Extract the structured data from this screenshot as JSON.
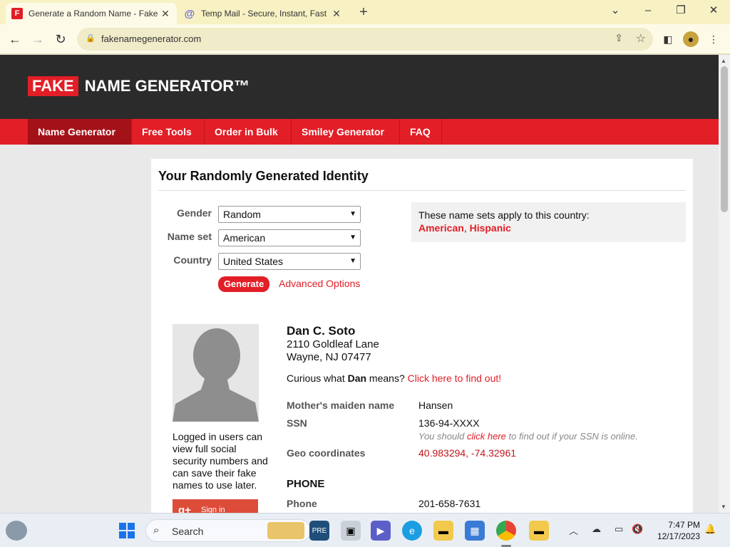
{
  "browser": {
    "tabs": [
      {
        "title": "Generate a Random Name - Fake",
        "favicon": "F",
        "active": true
      },
      {
        "title": "Temp Mail - Secure, Instant, Fast",
        "favicon": "@",
        "active": false
      }
    ],
    "url": "fakenamegenerator.com"
  },
  "site": {
    "logo_fake": "FAKE",
    "logo_rest": "NAME GENERATOR™",
    "nav": [
      "Name Generator",
      "Free Tools",
      "Order in Bulk",
      "Smiley Generator",
      "FAQ"
    ]
  },
  "form": {
    "heading": "Your Randomly Generated Identity",
    "gender_label": "Gender",
    "gender_value": "Random",
    "nameset_label": "Name set",
    "nameset_value": "American",
    "country_label": "Country",
    "country_value": "United States",
    "generate_label": "Generate",
    "advanced_label": "Advanced Options",
    "info_text": "These name sets apply to this country:",
    "info_set1": "American",
    "info_sep": ", ",
    "info_set2": "Hispanic"
  },
  "identity": {
    "name": "Dan C. Soto",
    "address1": "2110 Goldleaf Lane",
    "address2": "Wayne, NJ 07477",
    "curious_pre": "Curious what ",
    "curious_name": "Dan",
    "curious_mid": " means? ",
    "curious_link": "Click here to find out!",
    "maiden_label": "Mother's maiden name",
    "maiden_value": "Hansen",
    "ssn_label": "SSN",
    "ssn_value": "136-94-XXXX",
    "ssn_note_pre": "You should ",
    "ssn_note_link": "click here",
    "ssn_note_post": " to find out if your SSN is online.",
    "geo_label": "Geo coordinates",
    "geo_value": "40.983294, -74.32961",
    "phone_section": "PHONE",
    "phone_label": "Phone",
    "phone_value": "201-658-7631",
    "login_note": "Logged in users can view full social security numbers and can save their fake names to use later.",
    "signin_g": "g+",
    "signin_label": "Sign in"
  },
  "taskbar": {
    "search_label": "Search",
    "time": "7:47 PM",
    "date": "12/17/2023"
  }
}
